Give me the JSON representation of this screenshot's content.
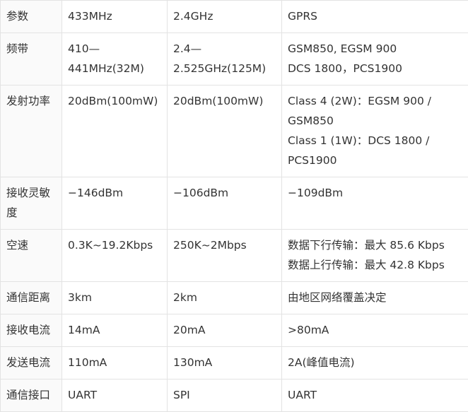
{
  "table": {
    "rows": [
      {
        "label": "参数",
        "c433": [
          "433MHz"
        ],
        "c24": [
          "2.4GHz"
        ],
        "gprs": [
          "GPRS"
        ]
      },
      {
        "label": "频带",
        "c433": [
          "410—",
          "441MHz(32M)"
        ],
        "c24": [
          "2.4—",
          "2.525GHz(125M)"
        ],
        "gprs": [
          "GSM850, EGSM 900",
          "DCS 1800，PCS1900"
        ]
      },
      {
        "label": "发射功率",
        "c433": [
          "20dBm(100mW)"
        ],
        "c24": [
          "20dBm(100mW)"
        ],
        "gprs": [
          "Class 4 (2W)：EGSM 900 /",
          "GSM850",
          "Class 1 (1W)：DCS 1800 /",
          "PCS1900"
        ]
      },
      {
        "label": "接收灵敏度",
        "c433": [
          "−146dBm"
        ],
        "c24": [
          "−106dBm"
        ],
        "gprs": [
          "−109dBm"
        ]
      },
      {
        "label": "空速",
        "c433": [
          "0.3K~19.2Kbps"
        ],
        "c24": [
          "250K~2Mbps"
        ],
        "gprs": [
          "数据下行传输：最大 85.6 Kbps",
          "数据上行传输：最大 42.8 Kbps"
        ]
      },
      {
        "label": "通信距离",
        "c433": [
          "3km"
        ],
        "c24": [
          "2km"
        ],
        "gprs": [
          "由地区网络覆盖决定"
        ]
      },
      {
        "label": "接收电流",
        "c433": [
          "14mA"
        ],
        "c24": [
          "20mA"
        ],
        "gprs": [
          ">80mA"
        ]
      },
      {
        "label": "发送电流",
        "c433": [
          "110mA"
        ],
        "c24": [
          "130mA"
        ],
        "gprs": [
          "2A(峰值电流)"
        ]
      },
      {
        "label": "通信接口",
        "c433": [
          "UART"
        ],
        "c24": [
          "SPI"
        ],
        "gprs": [
          "UART"
        ]
      }
    ]
  }
}
